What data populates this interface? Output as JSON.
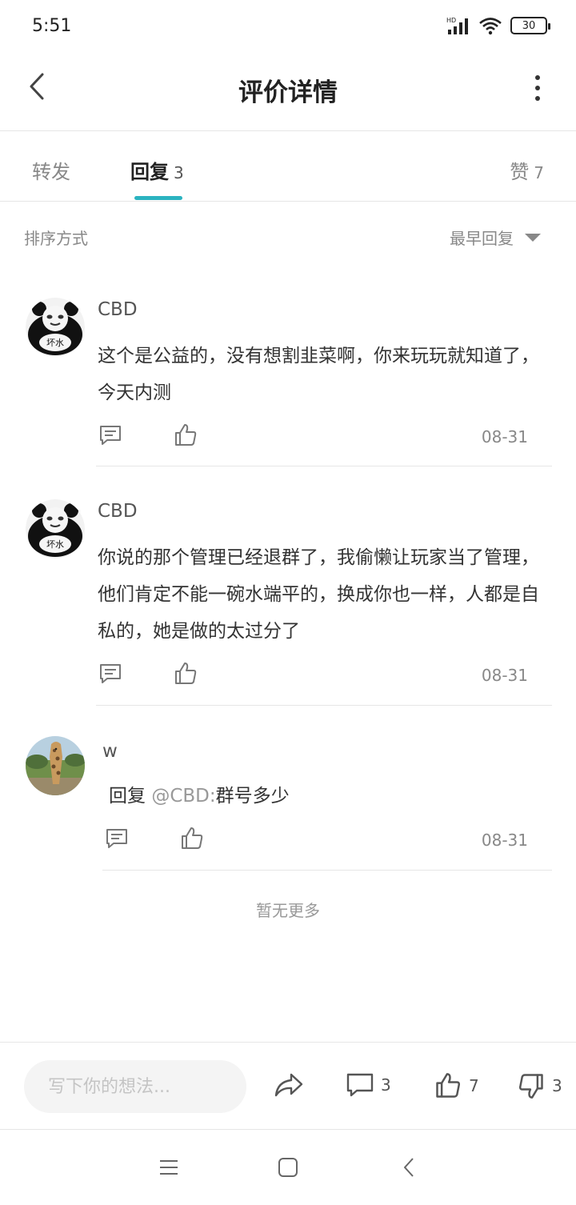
{
  "status_bar": {
    "time": "5:51",
    "hd": "HD",
    "battery": "30"
  },
  "nav": {
    "title": "评价详情"
  },
  "tabs": {
    "forward": {
      "label": "转发"
    },
    "reply": {
      "label": "回复",
      "count": "3"
    },
    "like": {
      "label": "赞",
      "count": "7"
    }
  },
  "sort": {
    "label": "排序方式",
    "value": "最早回复"
  },
  "comments": [
    {
      "user": "CBD",
      "avatar_text": "坏水",
      "text": "这个是公益的，没有想割韭菜啊，你来玩玩就知道了，今天内测",
      "date": "08-31"
    },
    {
      "user": "CBD",
      "avatar_text": "坏水",
      "text": "你说的那个管理已经退群了，我偷懒让玩家当了管理，他们肯定不能一碗水端平的，换成你也一样，人都是自私的，她是做的太过分了",
      "date": "08-31"
    },
    {
      "user": "w",
      "reply_prefix": "回复",
      "mention": "@CBD:",
      "text": "群号多少",
      "date": "08-31"
    }
  ],
  "footer_note": "暂无更多",
  "bottom_bar": {
    "input_placeholder": "写下你的想法...",
    "comment_count": "3",
    "like_count": "7",
    "dislike_count": "3"
  },
  "colors": {
    "accent": "#2bb3c0",
    "text_primary": "#222222",
    "text_secondary": "#888888"
  }
}
